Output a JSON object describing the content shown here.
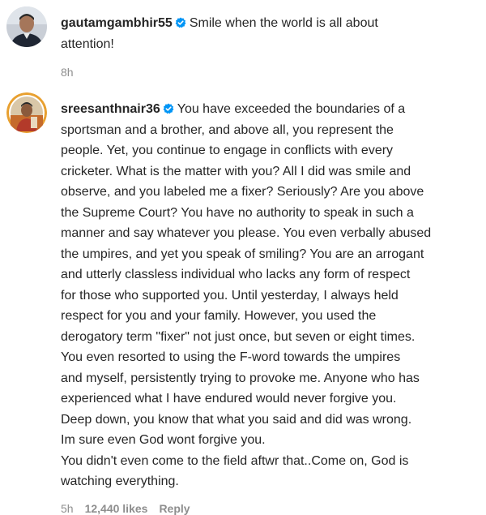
{
  "comments": [
    {
      "username": "gautamgambhir55",
      "verified": true,
      "lines": [
        "Smile when the world is all about",
        "attention!"
      ],
      "time": "8h"
    },
    {
      "username": "sreesanthnair36",
      "verified": true,
      "lines": [
        "You have exceeded the boundaries of a",
        "sportsman and a brother, and above all, you represent the",
        "people. Yet, you continue to engage in conflicts with every",
        "cricketer. What is the matter with you? All I did was smile and",
        "observe, and you labeled me a fixer? Seriously? Are you above",
        "the Supreme Court? You have no authority to speak in such a",
        "manner and say whatever you please. You even verbally abused",
        "the umpires, and yet you speak of smiling? You are an arrogant",
        "and utterly classless individual who lacks any form of respect",
        "for those who supported you. Until yesterday, I always held",
        "respect for you and your family. However, you used the",
        "derogatory term \"fixer\" not just once, but seven or eight times.",
        "You even resorted to using the F-word towards the umpires",
        "and myself, persistently trying to provoke me. Anyone who has",
        "experienced what I have endured would never forgive you.",
        "Deep down, you know that what you said and did was wrong.",
        "Im sure even God wont forgive you.",
        "You didn't even come to the field aftwr that..Come on, God is",
        "watching everything."
      ],
      "time": "5h",
      "likes": "12,440 likes",
      "reply_label": "Reply"
    }
  ],
  "colors": {
    "text": "#262626",
    "meta": "#8e8e8e",
    "verified": "#0095f6"
  }
}
